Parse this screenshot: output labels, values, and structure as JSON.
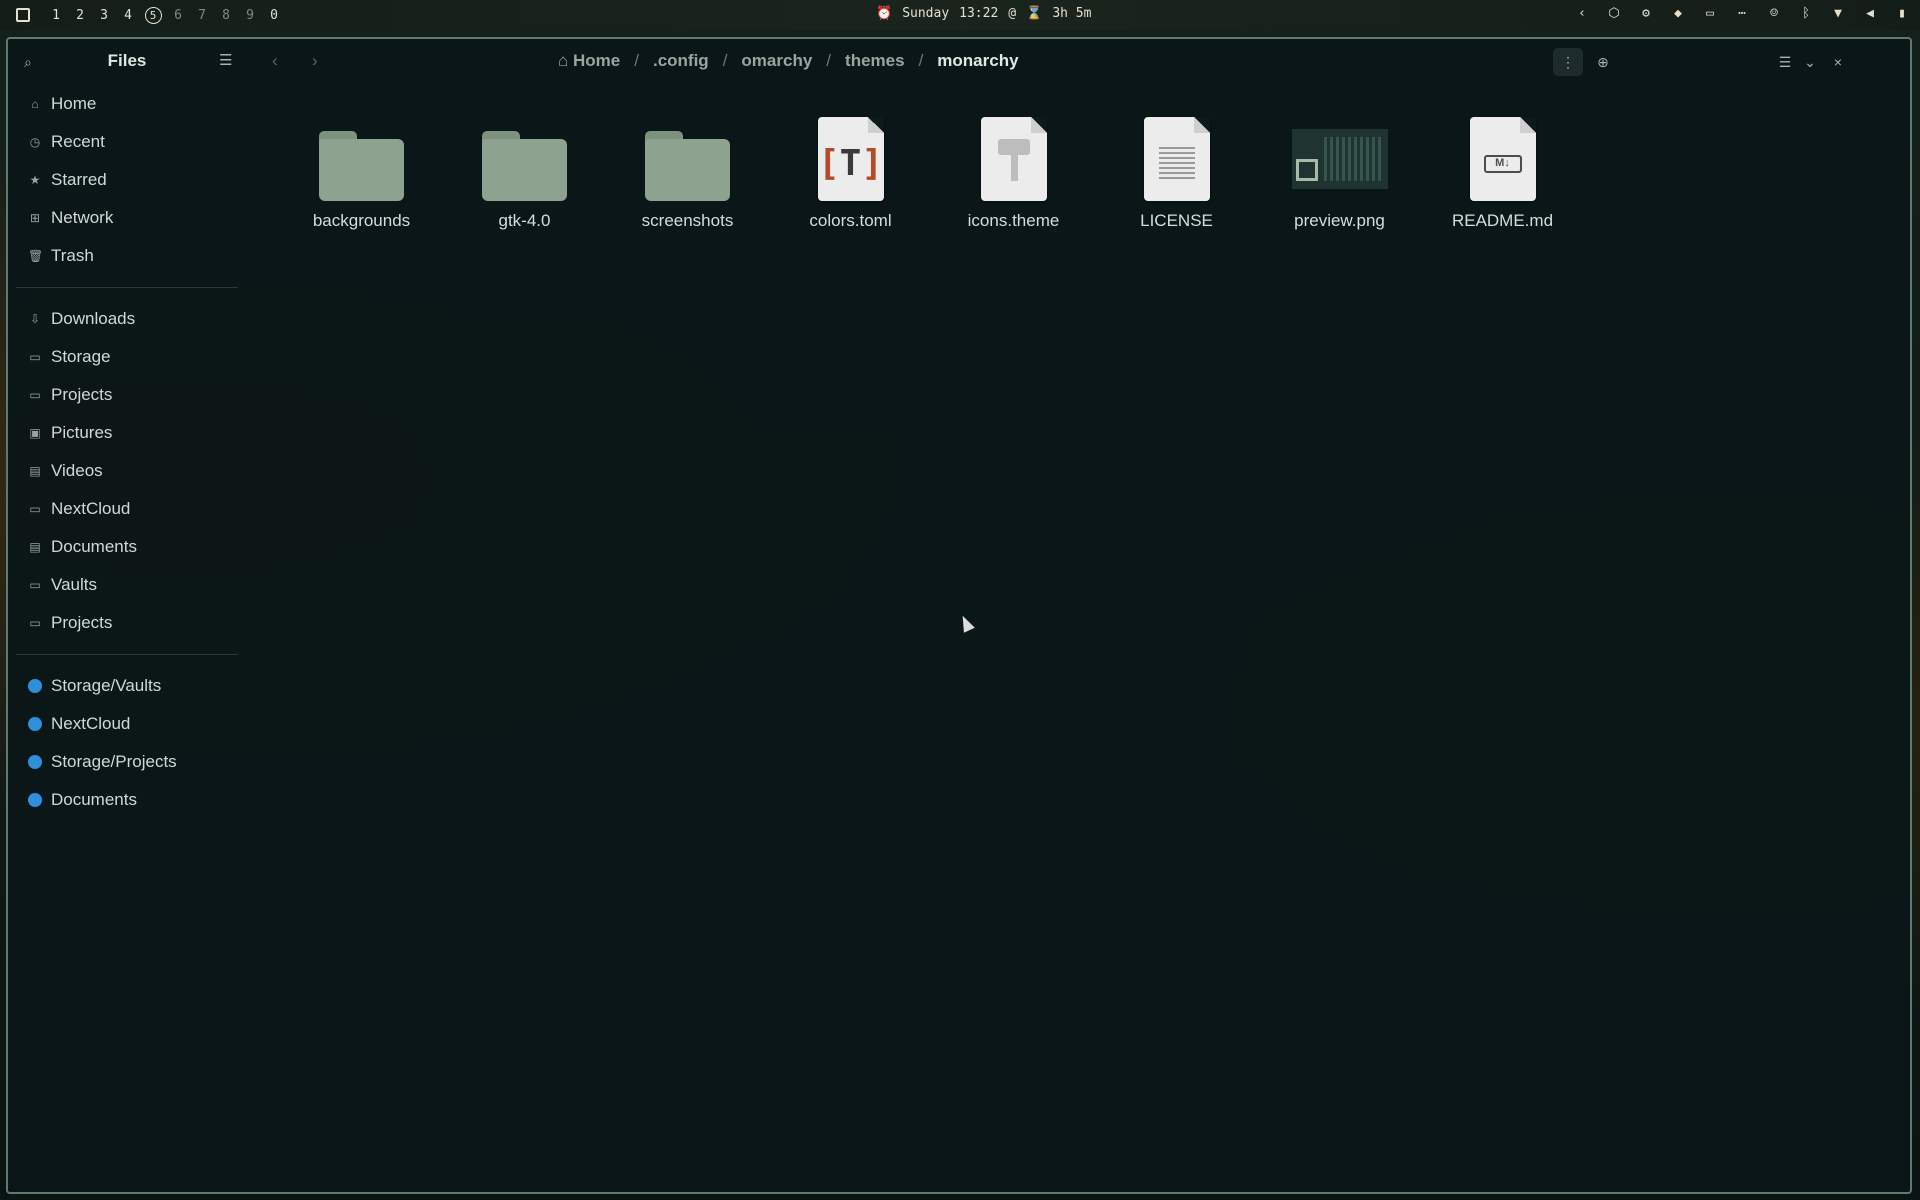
{
  "topbar": {
    "workspaces": [
      "1",
      "2",
      "3",
      "4",
      "5",
      "6",
      "7",
      "8",
      "9",
      "0"
    ],
    "active_workspace": "5",
    "day": "Sunday",
    "time": "13:22",
    "battery_time": "3h 5m"
  },
  "window": {
    "sidebar_title": "Files",
    "places": [
      {
        "label": "Home",
        "icon": "home-icon"
      },
      {
        "label": "Recent",
        "icon": "clock-icon"
      },
      {
        "label": "Starred",
        "icon": "star-icon"
      },
      {
        "label": "Network",
        "icon": "network-icon"
      },
      {
        "label": "Trash",
        "icon": "trash-icon"
      }
    ],
    "bookmarks": [
      {
        "label": "Downloads",
        "icon": "download-icon"
      },
      {
        "label": "Storage",
        "icon": "folder-icon"
      },
      {
        "label": "Projects",
        "icon": "folder-icon"
      },
      {
        "label": "Pictures",
        "icon": "picture-icon"
      },
      {
        "label": "Videos",
        "icon": "video-icon"
      },
      {
        "label": "NextCloud",
        "icon": "folder-icon"
      },
      {
        "label": "Documents",
        "icon": "document-icon"
      },
      {
        "label": "Vaults",
        "icon": "folder-icon"
      },
      {
        "label": "Projects",
        "icon": "folder-icon"
      }
    ],
    "mounts": [
      {
        "label": "Storage/Vaults",
        "icon": "cloud-icon"
      },
      {
        "label": "NextCloud",
        "icon": "cloud-icon"
      },
      {
        "label": "Storage/Projects",
        "icon": "cloud-icon"
      },
      {
        "label": "Documents",
        "icon": "cloud-icon"
      }
    ],
    "breadcrumb": [
      "Home",
      ".config",
      "omarchy",
      "themes",
      "monarchy"
    ],
    "files": [
      {
        "name": "backgrounds",
        "type": "folder"
      },
      {
        "name": "gtk-4.0",
        "type": "folder"
      },
      {
        "name": "screenshots",
        "type": "folder"
      },
      {
        "name": "colors.toml",
        "type": "toml"
      },
      {
        "name": "icons.theme",
        "type": "theme"
      },
      {
        "name": "LICENSE",
        "type": "text"
      },
      {
        "name": "preview.png",
        "type": "image"
      },
      {
        "name": "README.md",
        "type": "markdown"
      }
    ]
  }
}
